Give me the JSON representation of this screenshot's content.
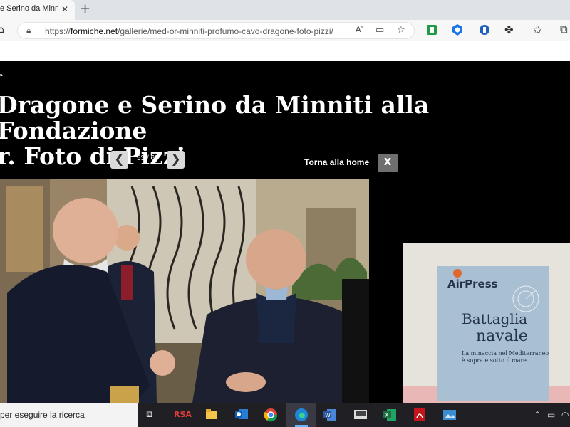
{
  "browser": {
    "tab_title": "e Serino da Minniti",
    "tab_close": "✕",
    "new_tab": "+",
    "url_prefix": "https://",
    "url_domain": "formiche.net",
    "url_path": "/gallerie/med-or-minniti-profumo-cavo-dragone-foto-pizzi/",
    "read_aloud": "Aʾ"
  },
  "gallery": {
    "brand_letter": "e",
    "headline_line1": "Dragone e Serino da Minniti alla Fondazione",
    "headline_line2": "r. Foto di Pizzi",
    "prev_symbol": "❮",
    "next_symbol": "❯",
    "counter": "53 / 69",
    "home_link": "Torna alla home",
    "close_label": "X"
  },
  "ad": {
    "brand": "AirPress",
    "title_line1": "Battaglia",
    "title_line2": "navale",
    "subtitle_line1": "La minaccia nel Mediterraneo",
    "subtitle_line2": "è sopra e sotto il mare"
  },
  "taskbar": {
    "search_text": "per eseguire la ricerca",
    "rsa_label": "RSA"
  },
  "colors": {
    "accent_blue": "#1a73e8",
    "magazine_blue": "#9fb5c9",
    "adobe_red": "#c4151c",
    "excel_green": "#1d6f42",
    "word_blue": "#2b579a"
  }
}
